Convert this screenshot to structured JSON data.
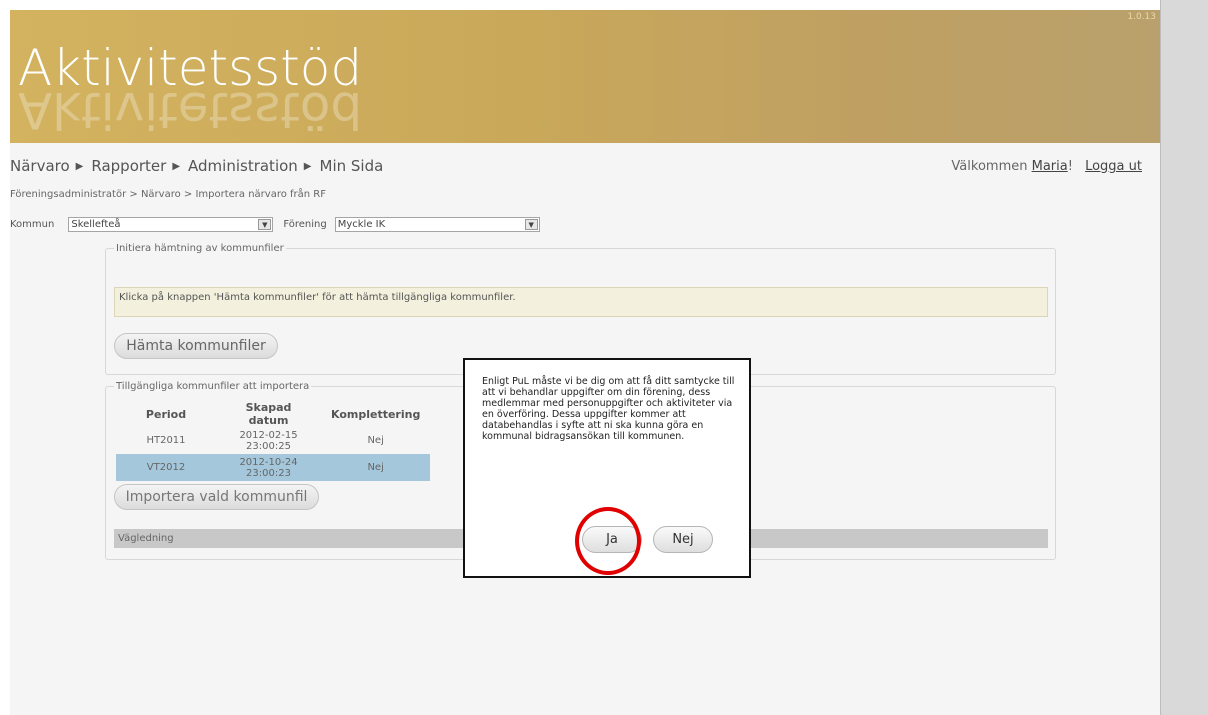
{
  "app": {
    "title": "Aktivitetsstöd",
    "version": "1.0.13"
  },
  "nav": {
    "items": [
      "Närvaro",
      "Rapporter",
      "Administration",
      "Min Sida"
    ],
    "welcome_prefix": "Välkommen ",
    "user": "Maria",
    "welcome_suffix": "!",
    "logout": "Logga ut"
  },
  "breadcrumb": "Föreningsadministratör > Närvaro > Importera närvaro från RF",
  "filters": {
    "kommun_label": "Kommun",
    "kommun_value": "Skellefteå",
    "forening_label": "Förening",
    "forening_value": "Myckle IK"
  },
  "fetch_section": {
    "legend": "Initiera hämtning av kommunfiler",
    "info": "Klicka på knappen 'Hämta kommunfiler' för att hämta tillgängliga kommunfiler.",
    "button": "Hämta kommunfiler"
  },
  "files_section": {
    "legend": "Tillgängliga kommunfiler att importera",
    "headers": [
      "Period",
      "Skapad datum",
      "Komplettering"
    ],
    "rows": [
      {
        "period": "HT2011",
        "date": "2012-02-15",
        "time": "23:00:25",
        "complement": "Nej",
        "selected": false
      },
      {
        "period": "VT2012",
        "date": "2012-10-24",
        "time": "23:00:23",
        "complement": "Nej",
        "selected": true
      }
    ],
    "import_button": "Importera vald kommunfil",
    "guide": "Vägledning"
  },
  "dialog": {
    "message": "Enligt PuL måste vi be dig om att få ditt samtycke till att vi behandlar uppgifter om din förening, dess medlemmar med personuppgifter och aktiviteter via en överföring. Dessa uppgifter kommer att databehandlas i syfte att ni ska kunna göra en kommunal bidragsansökan till kommunen.",
    "yes": "Ja",
    "no": "Nej"
  },
  "colors": {
    "banner": "#c9a85a",
    "selected_row": "#a4c7dc",
    "highlight": "#e00000"
  }
}
